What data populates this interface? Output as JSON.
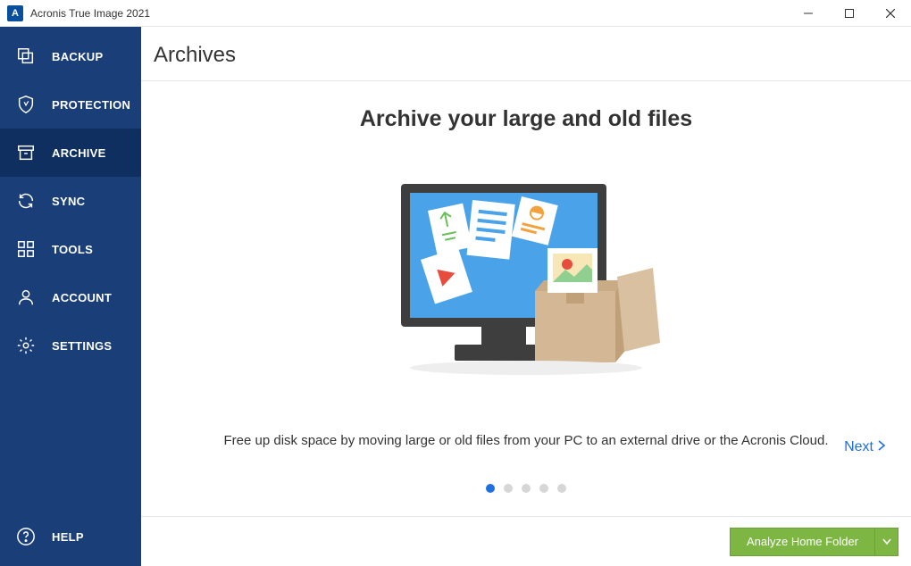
{
  "window": {
    "title": "Acronis True Image 2021"
  },
  "sidebar": {
    "items": [
      {
        "label": "BACKUP"
      },
      {
        "label": "PROTECTION"
      },
      {
        "label": "ARCHIVE"
      },
      {
        "label": "SYNC"
      },
      {
        "label": "TOOLS"
      },
      {
        "label": "ACCOUNT"
      },
      {
        "label": "SETTINGS"
      }
    ],
    "help_label": "HELP",
    "active_index": 2
  },
  "page": {
    "header": "Archives",
    "hero_title": "Archive your large and old files",
    "hero_sub": "Free up disk space by moving large or old files from your PC to an external drive or the Acronis Cloud.",
    "next_label": "Next",
    "pager_count": 5,
    "pager_active": 0
  },
  "footer": {
    "analyze_label": "Analyze Home Folder"
  },
  "colors": {
    "sidebar_bg": "#1a3e78",
    "sidebar_active": "#0f2f60",
    "accent_blue": "#1f6fe0",
    "accent_green": "#7db642"
  }
}
